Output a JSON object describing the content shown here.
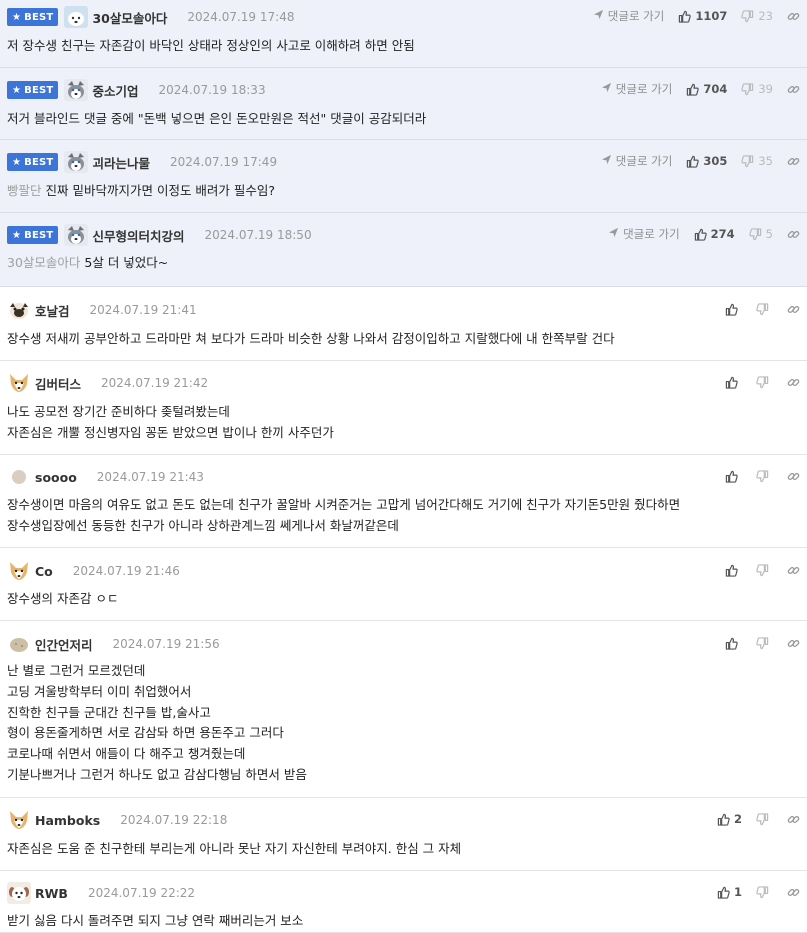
{
  "labels": {
    "best": "BEST",
    "reply_link": "댓글로 가기"
  },
  "colors": {
    "best_badge": "#3d74d8",
    "best_row_bg": "#eef1f9"
  },
  "comments": [
    {
      "best": true,
      "avatar": "white-dog-icon",
      "nick": "30살모솔아다",
      "date": "2024.07.19 17:48",
      "mention": "",
      "text": "저 장수생 친구는 자존감이 바닥인 상태라 정상인의 사고로 이해하려 하면 안됨",
      "up": "1107",
      "down": "23"
    },
    {
      "best": true,
      "avatar": "husky-icon",
      "nick": "중소기업",
      "date": "2024.07.19 18:33",
      "mention": "",
      "text": "저거 블라인드 댓글 중에 \"돈백 넣으면 은인 돈오만원은 적선\" 댓글이 공감되더라",
      "up": "704",
      "down": "39"
    },
    {
      "best": true,
      "avatar": "husky-icon",
      "nick": "괴라는나물",
      "date": "2024.07.19 17:49",
      "mention": "빵팔단",
      "text": "진짜 밑바닥까지가면 이정도 배려가 필수임?",
      "up": "305",
      "down": "35"
    },
    {
      "best": true,
      "avatar": "husky-icon",
      "nick": "신무형의터치강의",
      "date": "2024.07.19 18:50",
      "mention": "30살모솔아다",
      "text": "5살 더 넣었다~",
      "up": "274",
      "down": "5"
    },
    {
      "best": false,
      "avatar": "pug-icon",
      "nick": "호날검",
      "date": "2024.07.19 21:41",
      "mention": "",
      "text": "장수생 저새끼 공부안하고 드라마만 쳐 보다가 드라마 비슷한 상황 나와서 감정이입하고 지랄했다에 내 한쪽부랄 건다",
      "up": "",
      "down": ""
    },
    {
      "best": false,
      "avatar": "fox-icon",
      "nick": "김버터스",
      "date": "2024.07.19 21:42",
      "mention": "",
      "text": "나도 공모전 장기간 준비하다 좆털려봤는데\n자존심은 개뿔 정신병자임 꽁돈 받았으면 밥이나 한끼 사주던가",
      "up": "",
      "down": ""
    },
    {
      "best": false,
      "avatar": "dot-icon",
      "nick": "soooo",
      "date": "2024.07.19 21:43",
      "mention": "",
      "text": "장수생이면 마음의 여유도 없고 돈도 없는데 친구가 꿀알바 시켜준거는 고맙게 넘어간다해도 거기에 친구가 자기돈5만원 줬다하면\n장수생입장에선 동등한 친구가 아니라 상하관계느낌 쎄게나서 화날꺼같은데",
      "up": "",
      "down": ""
    },
    {
      "best": false,
      "avatar": "fox-icon",
      "nick": "Co",
      "date": "2024.07.19 21:46",
      "mention": "",
      "text": "장수생의 자존감 ㅇㄷ",
      "up": "",
      "down": ""
    },
    {
      "best": false,
      "avatar": "potato-icon",
      "nick": "인간언저리",
      "date": "2024.07.19 21:56",
      "mention": "",
      "text": "난 별로 그런거 모르겠던데\n고딩 겨울방학부터 이미 취업했어서\n진학한 친구들 군대간 친구들 밥,술사고\n형이 용돈줄게하면 서로 감삼돠 하면 용돈주고 그러다\n코로나때 쉬면서 애들이 다 해주고 챙겨줬는데\n기분나쁘거나 그런거 하나도 없고 감삼다행님 하면서 받음",
      "up": "",
      "down": ""
    },
    {
      "best": false,
      "avatar": "fox-icon",
      "nick": "Hamboks",
      "date": "2024.07.19 22:18",
      "mention": "",
      "text": "자존심은 도움 준 친구한테 부리는게 아니라 못난 자기 자신한테 부려야지. 한심 그 자체",
      "up": "2",
      "down": ""
    },
    {
      "best": false,
      "avatar": "puppy-icon",
      "nick": "RWB",
      "date": "2024.07.19 22:22",
      "mention": "",
      "text": "받기 싫음 다시 돌려주면 되지 그냥 연락 째버리는거 보소",
      "up": "1",
      "down": ""
    }
  ]
}
